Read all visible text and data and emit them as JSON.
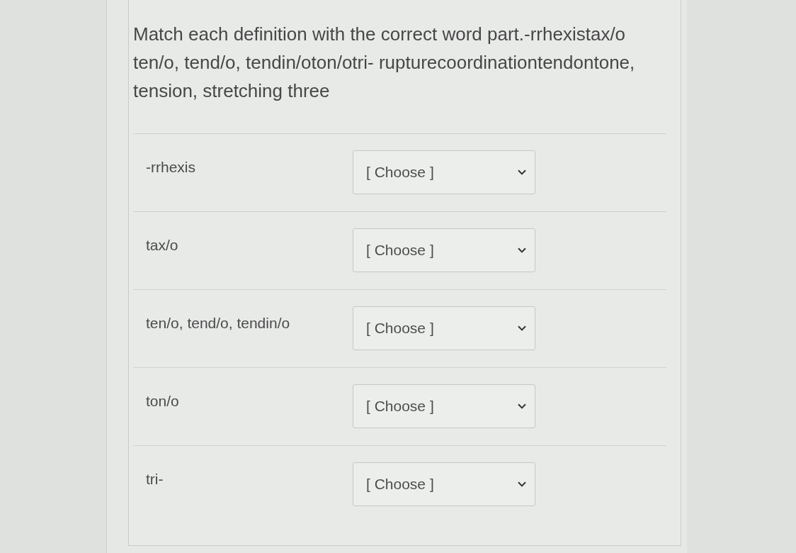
{
  "question": {
    "prompt": "Match each definition with the correct word part.-rrhexistax/o ten/o, tend/o, tendin/oton/otri- rupturecoordinationtendontone, tension, stretching three"
  },
  "pairs": [
    {
      "term": "-rrhexis",
      "answer": {
        "value": "[ Choose ]"
      }
    },
    {
      "term": "tax/o",
      "answer": {
        "value": "[ Choose ]"
      }
    },
    {
      "term": "ten/o, tend/o, tendin/o",
      "answer": {
        "value": "[ Choose ]"
      }
    },
    {
      "term": "ton/o",
      "answer": {
        "value": "[ Choose ]"
      }
    },
    {
      "term": "tri-",
      "answer": {
        "value": "[ Choose ]"
      }
    }
  ]
}
